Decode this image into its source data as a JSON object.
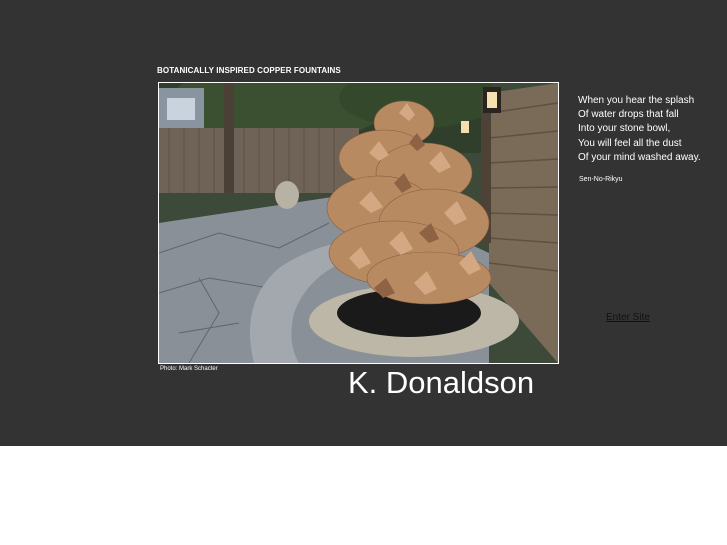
{
  "heading": "BOTANICALLY INSPIRED COPPER FOUNTAINS",
  "photo": {
    "description_icon": "copper-leaf-fountain-photo",
    "credit": "Photo: Mark Schacter"
  },
  "artist_name": "K. Donaldson",
  "poem": {
    "lines": [
      "When you hear the splash",
      "Of water drops that fall",
      "Into your stone bowl,",
      "You will feel all the dust",
      "Of your mind washed away."
    ],
    "author": "Sen-No-Rikyu"
  },
  "enter_link": "Enter Site",
  "colors": {
    "background": "#333333",
    "text": "#ffffff",
    "link": "#111111",
    "page": "#ffffff"
  }
}
